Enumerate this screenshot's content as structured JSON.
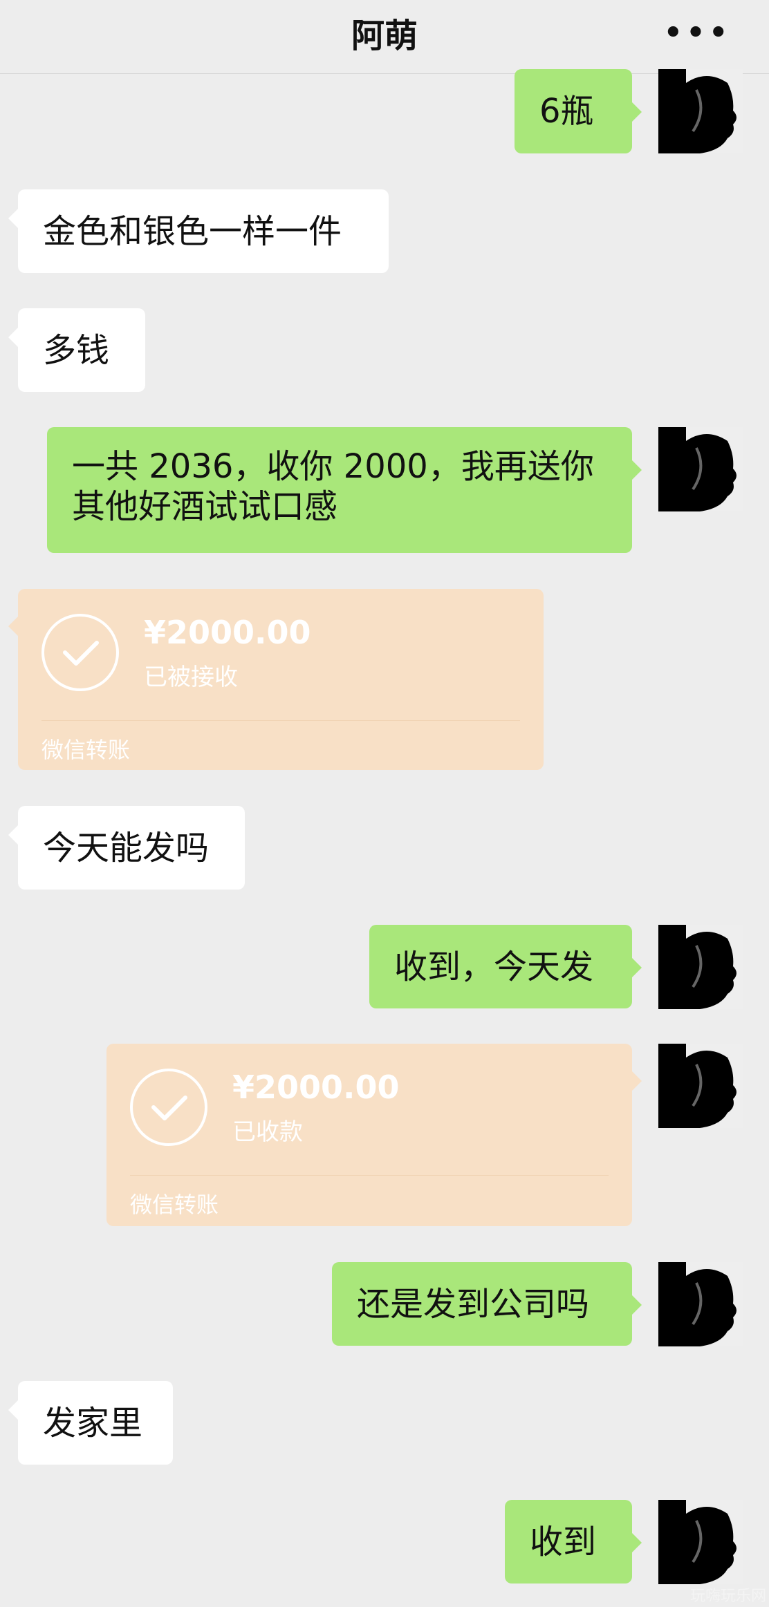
{
  "header": {
    "title": "阿萌",
    "more_icon": "more-dots-icon",
    "more_glyph": "•••"
  },
  "messages": {
    "m1": "6瓶",
    "m2": "金色和银色一样一件",
    "m3": "多钱",
    "m4_line1": "一共 2036，收你 2000，我再送你",
    "m4_line2": "其他好酒试试口感",
    "t1": {
      "amount": "¥2000.00",
      "status": "已被接收",
      "footer": "微信转账"
    },
    "m5": "今天能发吗",
    "m6": "收到，今天发",
    "t2": {
      "amount": "¥2000.00",
      "status": "已收款",
      "footer": "微信转账"
    },
    "m7": "还是发到公司吗",
    "m8": "发家里",
    "m9": "收到"
  },
  "watermark": "玩嗨玩乐网",
  "colors": {
    "background": "#ededed",
    "self_bubble": "#a9e77a",
    "other_bubble": "#ffffff",
    "transfer_card": "#f8e0c6"
  }
}
